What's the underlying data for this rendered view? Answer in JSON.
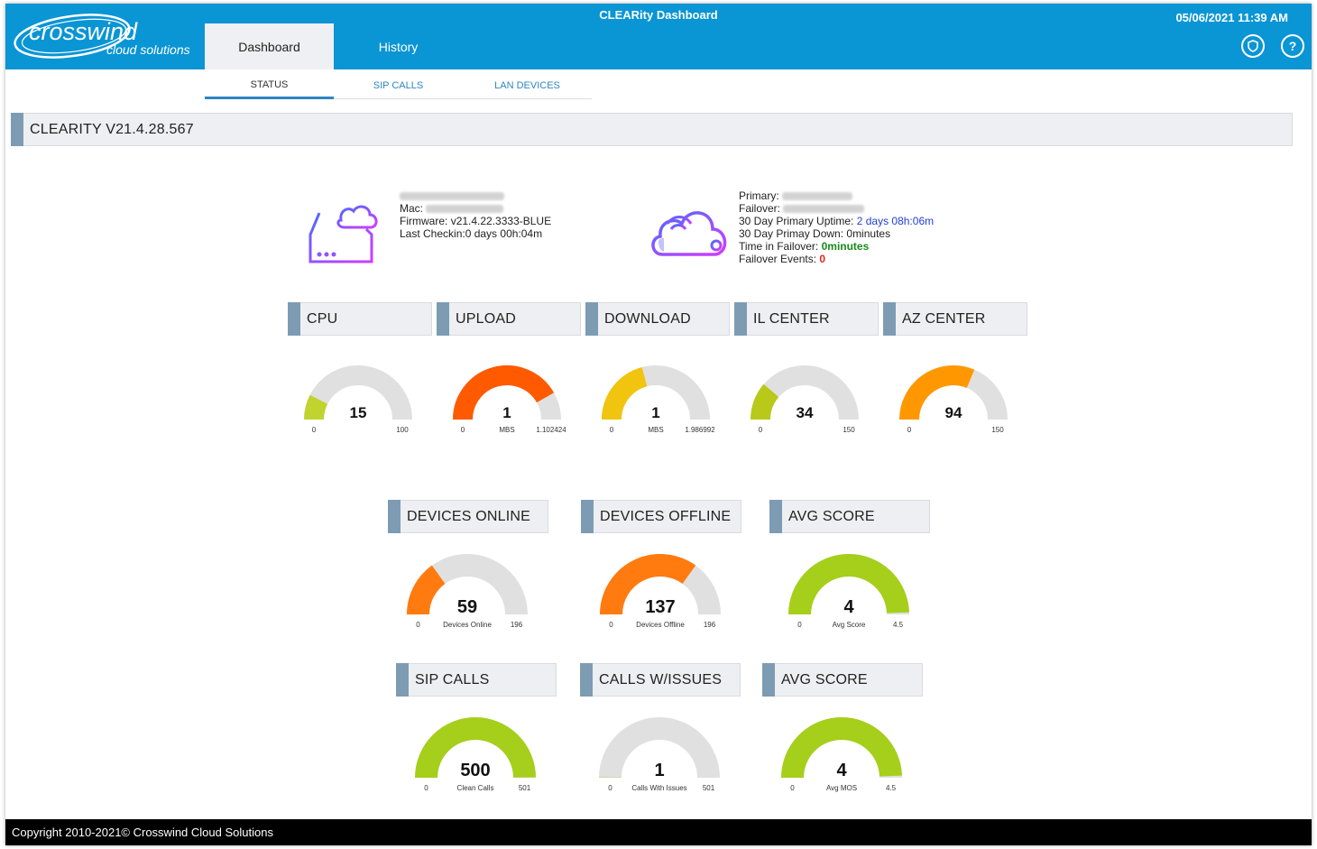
{
  "app": {
    "title": "CLEARity Dashboard",
    "datetime": "05/06/2021 11:39 AM",
    "brand": {
      "name": "crosswind",
      "tagline": "cloud solutions"
    }
  },
  "nav": {
    "tabs": [
      {
        "label": "Dashboard",
        "active": true
      },
      {
        "label": "History",
        "active": false
      }
    ]
  },
  "subtabs": [
    {
      "label": "STATUS",
      "active": true
    },
    {
      "label": "SIP CALLS",
      "active": false
    },
    {
      "label": "LAN DEVICES",
      "active": false
    }
  ],
  "version_banner": "CLEARITY V21.4.28.567",
  "device": {
    "mac_label": "Mac:",
    "firmware_label": "Firmware:",
    "firmware": "v21.4.22.3333-BLUE",
    "last_checkin_label": "Last Checkin:",
    "last_checkin": "0 days 00h:04m"
  },
  "wan": {
    "primary_label": "Primary:",
    "failover_label": "Failover:",
    "uptime_label": "30 Day Primary Uptime:",
    "uptime": "2 days 08h:06m",
    "down_label": "30 Day Primay Down:",
    "down": "0minutes",
    "time_failover_label": "Time in Failover:",
    "time_failover": "0minutes",
    "failover_events_label": "Failover Events:",
    "failover_events": "0"
  },
  "gauges": [
    {
      "id": "cpu",
      "title": "CPU",
      "value": 15,
      "value_text": "15",
      "min": 0,
      "min_text": "0",
      "max": 100,
      "max_text": "100",
      "unit": "",
      "color": "#c1d32f"
    },
    {
      "id": "upload",
      "title": "UPLOAD",
      "value": 0.92,
      "value_text": "1",
      "min": 0,
      "min_text": "0",
      "max": 1.102424,
      "max_text": "1.102424",
      "unit": "MBS",
      "color": "#ff5a00"
    },
    {
      "id": "download",
      "title": "DOWNLOAD",
      "value": 0.83,
      "value_text": "1",
      "min": 0,
      "min_text": "0",
      "max": 1.986992,
      "max_text": "1.986992",
      "unit": "MBS",
      "color": "#f1c40f"
    },
    {
      "id": "il-center",
      "title": "IL CENTER",
      "value": 34,
      "value_text": "34",
      "min": 0,
      "min_text": "0",
      "max": 150,
      "max_text": "150",
      "unit": "",
      "color": "#b8c91a"
    },
    {
      "id": "az-center",
      "title": "AZ CENTER",
      "value": 94,
      "value_text": "94",
      "min": 0,
      "min_text": "0",
      "max": 150,
      "max_text": "150",
      "unit": "",
      "color": "#ff9800"
    },
    {
      "id": "devices-online",
      "title": "DEVICES ONLINE",
      "value": 59,
      "value_text": "59",
      "min": 0,
      "min_text": "0",
      "max": 196,
      "max_text": "196",
      "unit": "Devices Online",
      "color": "#ff7b0f"
    },
    {
      "id": "devices-offline",
      "title": "DEVICES OFFLINE",
      "value": 137,
      "value_text": "137",
      "min": 0,
      "min_text": "0",
      "max": 196,
      "max_text": "196",
      "unit": "Devices Offline",
      "color": "#ff7b0f"
    },
    {
      "id": "avg-score-devices",
      "title": "AVG SCORE",
      "value": 4.45,
      "value_text": "4",
      "min": 0,
      "min_text": "0",
      "max": 4.5,
      "max_text": "4.5",
      "unit": "Avg Score",
      "color": "#a5cf1a"
    },
    {
      "id": "sip-calls",
      "title": "SIP CALLS",
      "value": 500,
      "value_text": "500",
      "min": 0,
      "min_text": "0",
      "max": 501,
      "max_text": "501",
      "unit": "Clean Calls",
      "color": "#a5cf1a"
    },
    {
      "id": "calls-issues",
      "title": "CALLS W/ISSUES",
      "value": 1,
      "value_text": "1",
      "min": 0,
      "min_text": "0",
      "max": 501,
      "max_text": "501",
      "unit": "Calls With Issues",
      "color": "#a5cf1a"
    },
    {
      "id": "avg-score-calls",
      "title": "AVG SCORE",
      "value": 4.45,
      "value_text": "4",
      "min": 0,
      "min_text": "0",
      "max": 4.5,
      "max_text": "4.5",
      "unit": "Avg MOS",
      "color": "#a5cf1a"
    }
  ],
  "footer": "Copyright 2010-2021© Crosswind Cloud Solutions",
  "colors": {
    "topbar": "#0a95d4",
    "track": "#e0e0e0",
    "header_marker": "#7d9cb3"
  }
}
